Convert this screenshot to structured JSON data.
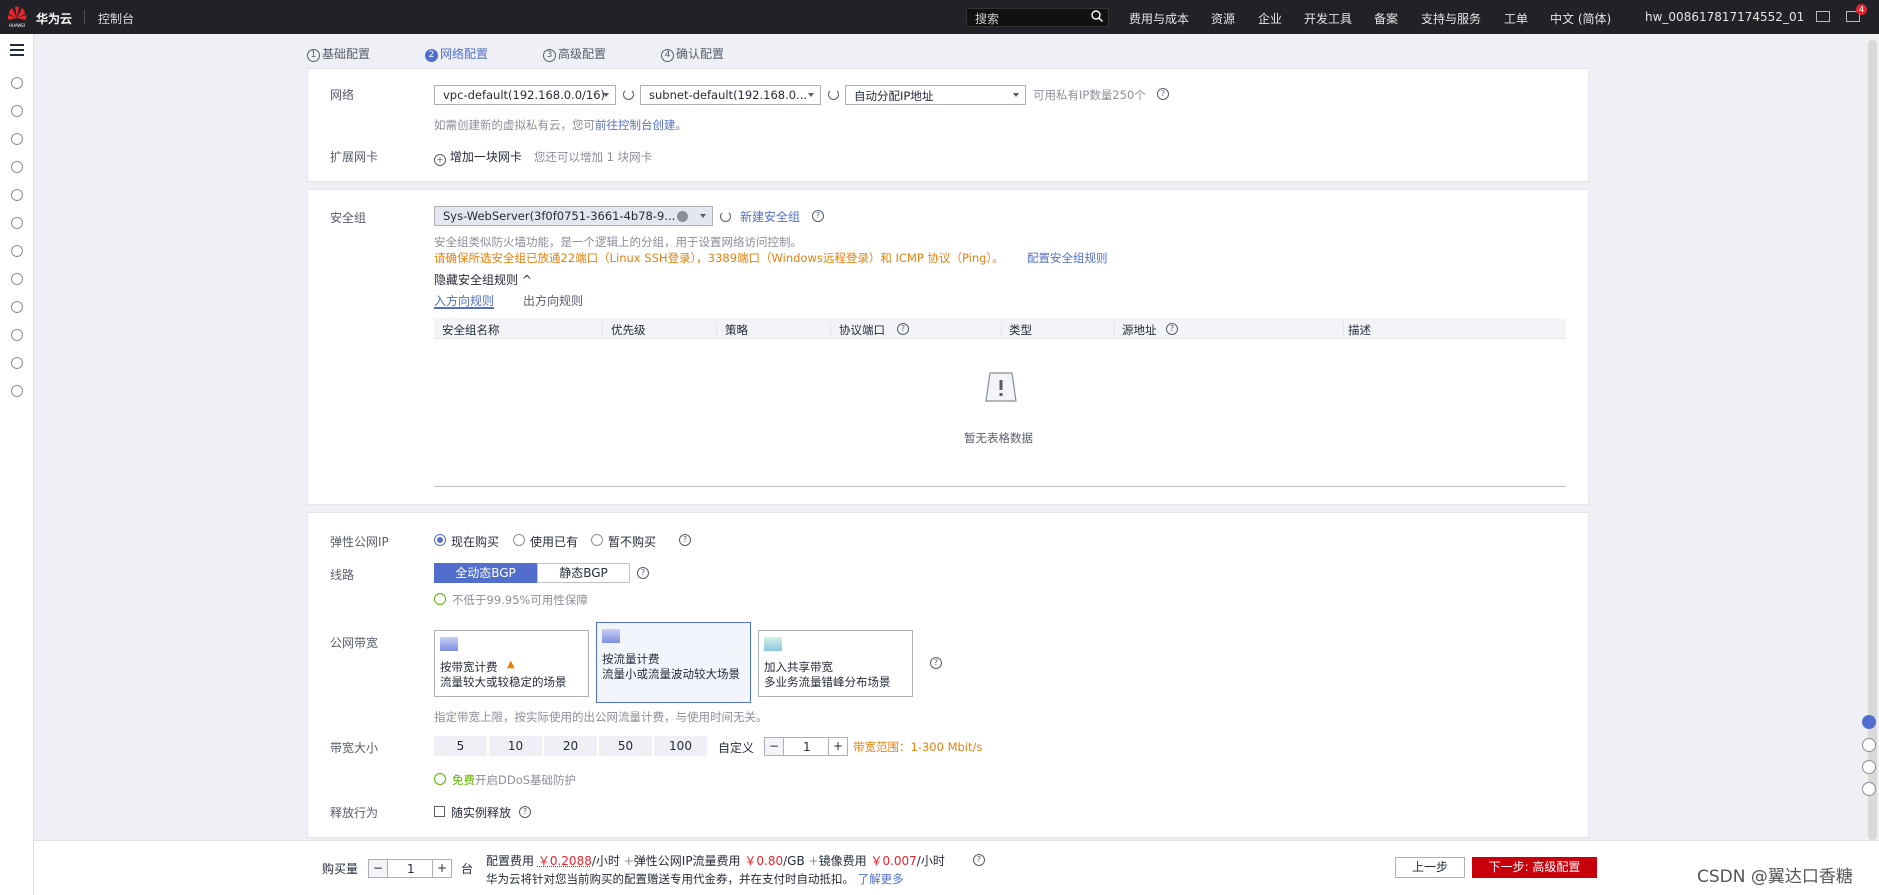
{
  "topbar": {
    "brand": "华为云",
    "console": "控制台",
    "search_placeholder": "搜索",
    "nav": [
      "费用与成本",
      "资源",
      "企业",
      "开发工具",
      "备案",
      "支持与服务",
      "工单",
      "中文 (简体)"
    ],
    "account": "hw_008617817174552_01",
    "notification_count": "4"
  },
  "steps": [
    {
      "num": "1",
      "label": "基础配置",
      "active": false
    },
    {
      "num": "2",
      "label": "网络配置",
      "active": true
    },
    {
      "num": "3",
      "label": "高级配置",
      "active": false
    },
    {
      "num": "4",
      "label": "确认配置",
      "active": false
    }
  ],
  "network": {
    "label": "网络",
    "vpc_value": "vpc-default(192.168.0.0/16)",
    "subnet_value": "subnet-default(192.168.0...",
    "ip_value": "自动分配IP地址",
    "ip_count": "可用私有IP数量250个",
    "hint_prefix": "如需创建新的虚拟私有云，您可",
    "hint_link": "前往控制台创建。",
    "nic_label": "扩展网卡",
    "add_nic": "增加一块网卡",
    "nic_hint": "您还可以增加 1 块网卡"
  },
  "security": {
    "label": "安全组",
    "value": "Sys-WebServer(3f0f0751-3661-4b78-9...",
    "new_link": "新建安全组",
    "desc": "安全组类似防火墙功能，是一个逻辑上的分组，用于设置网络访问控制。",
    "warning": "请确保所选安全组已放通22端口（Linux SSH登录），3389端口（Windows远程登录）和 ICMP 协议（Ping）。",
    "config_link": "配置安全组规则",
    "toggle": "隐藏安全组规则",
    "tabs": [
      "入方向规则",
      "出方向规则"
    ],
    "columns": [
      "安全组名称",
      "优先级",
      "策略",
      "协议端口",
      "类型",
      "源地址",
      "描述"
    ],
    "empty": "暂无表格数据"
  },
  "eip": {
    "label": "弹性公网IP",
    "options": [
      "现在购买",
      "使用已有",
      "暂不购买"
    ],
    "line_label": "线路",
    "lines": [
      "全动态BGP",
      "静态BGP"
    ],
    "sla": "不低于99.95%可用性保障",
    "bw_label": "公网带宽",
    "cards": [
      {
        "title": "按带宽计费",
        "desc": "流量较大或较稳定的场景"
      },
      {
        "title": "按流量计费",
        "desc": "流量小或流量波动较大场景"
      },
      {
        "title": "加入共享带宽",
        "desc": "多业务流量错峰分布场景"
      }
    ],
    "bw_hint": "指定带宽上限，按实际使用的出公网流量计费，与使用时间无关。",
    "size_label": "带宽大小",
    "sizes": [
      "5",
      "10",
      "20",
      "50",
      "100"
    ],
    "custom": "自定义",
    "size_value": "1",
    "range": "带宽范围：1-300 Mbit/s",
    "ddos_free": "免费",
    "ddos": "开启DDoS基础防护",
    "release_label": "释放行为",
    "release_option": "随实例释放"
  },
  "footer": {
    "qty_label": "购买量",
    "qty_value": "1",
    "qty_unit": "台",
    "config_fee_label": "配置费用",
    "config_fee": "￥0.2088",
    "per_hour": "/小时",
    "plus": "+",
    "eip_fee_label": "弹性公网IP流量费用",
    "eip_fee": "￥0.80",
    "per_gb": "/GB",
    "image_fee_label": "镜像费用",
    "image_fee": "￥0.007",
    "note": "华为云将针对您当前购买的配置赠送专用代金券，并在支付时自动抵扣。",
    "learn_more": "了解更多",
    "prev": "上一步",
    "next": "下一步: 高级配置"
  },
  "watermark": "CSDN @翼达口香糖"
}
